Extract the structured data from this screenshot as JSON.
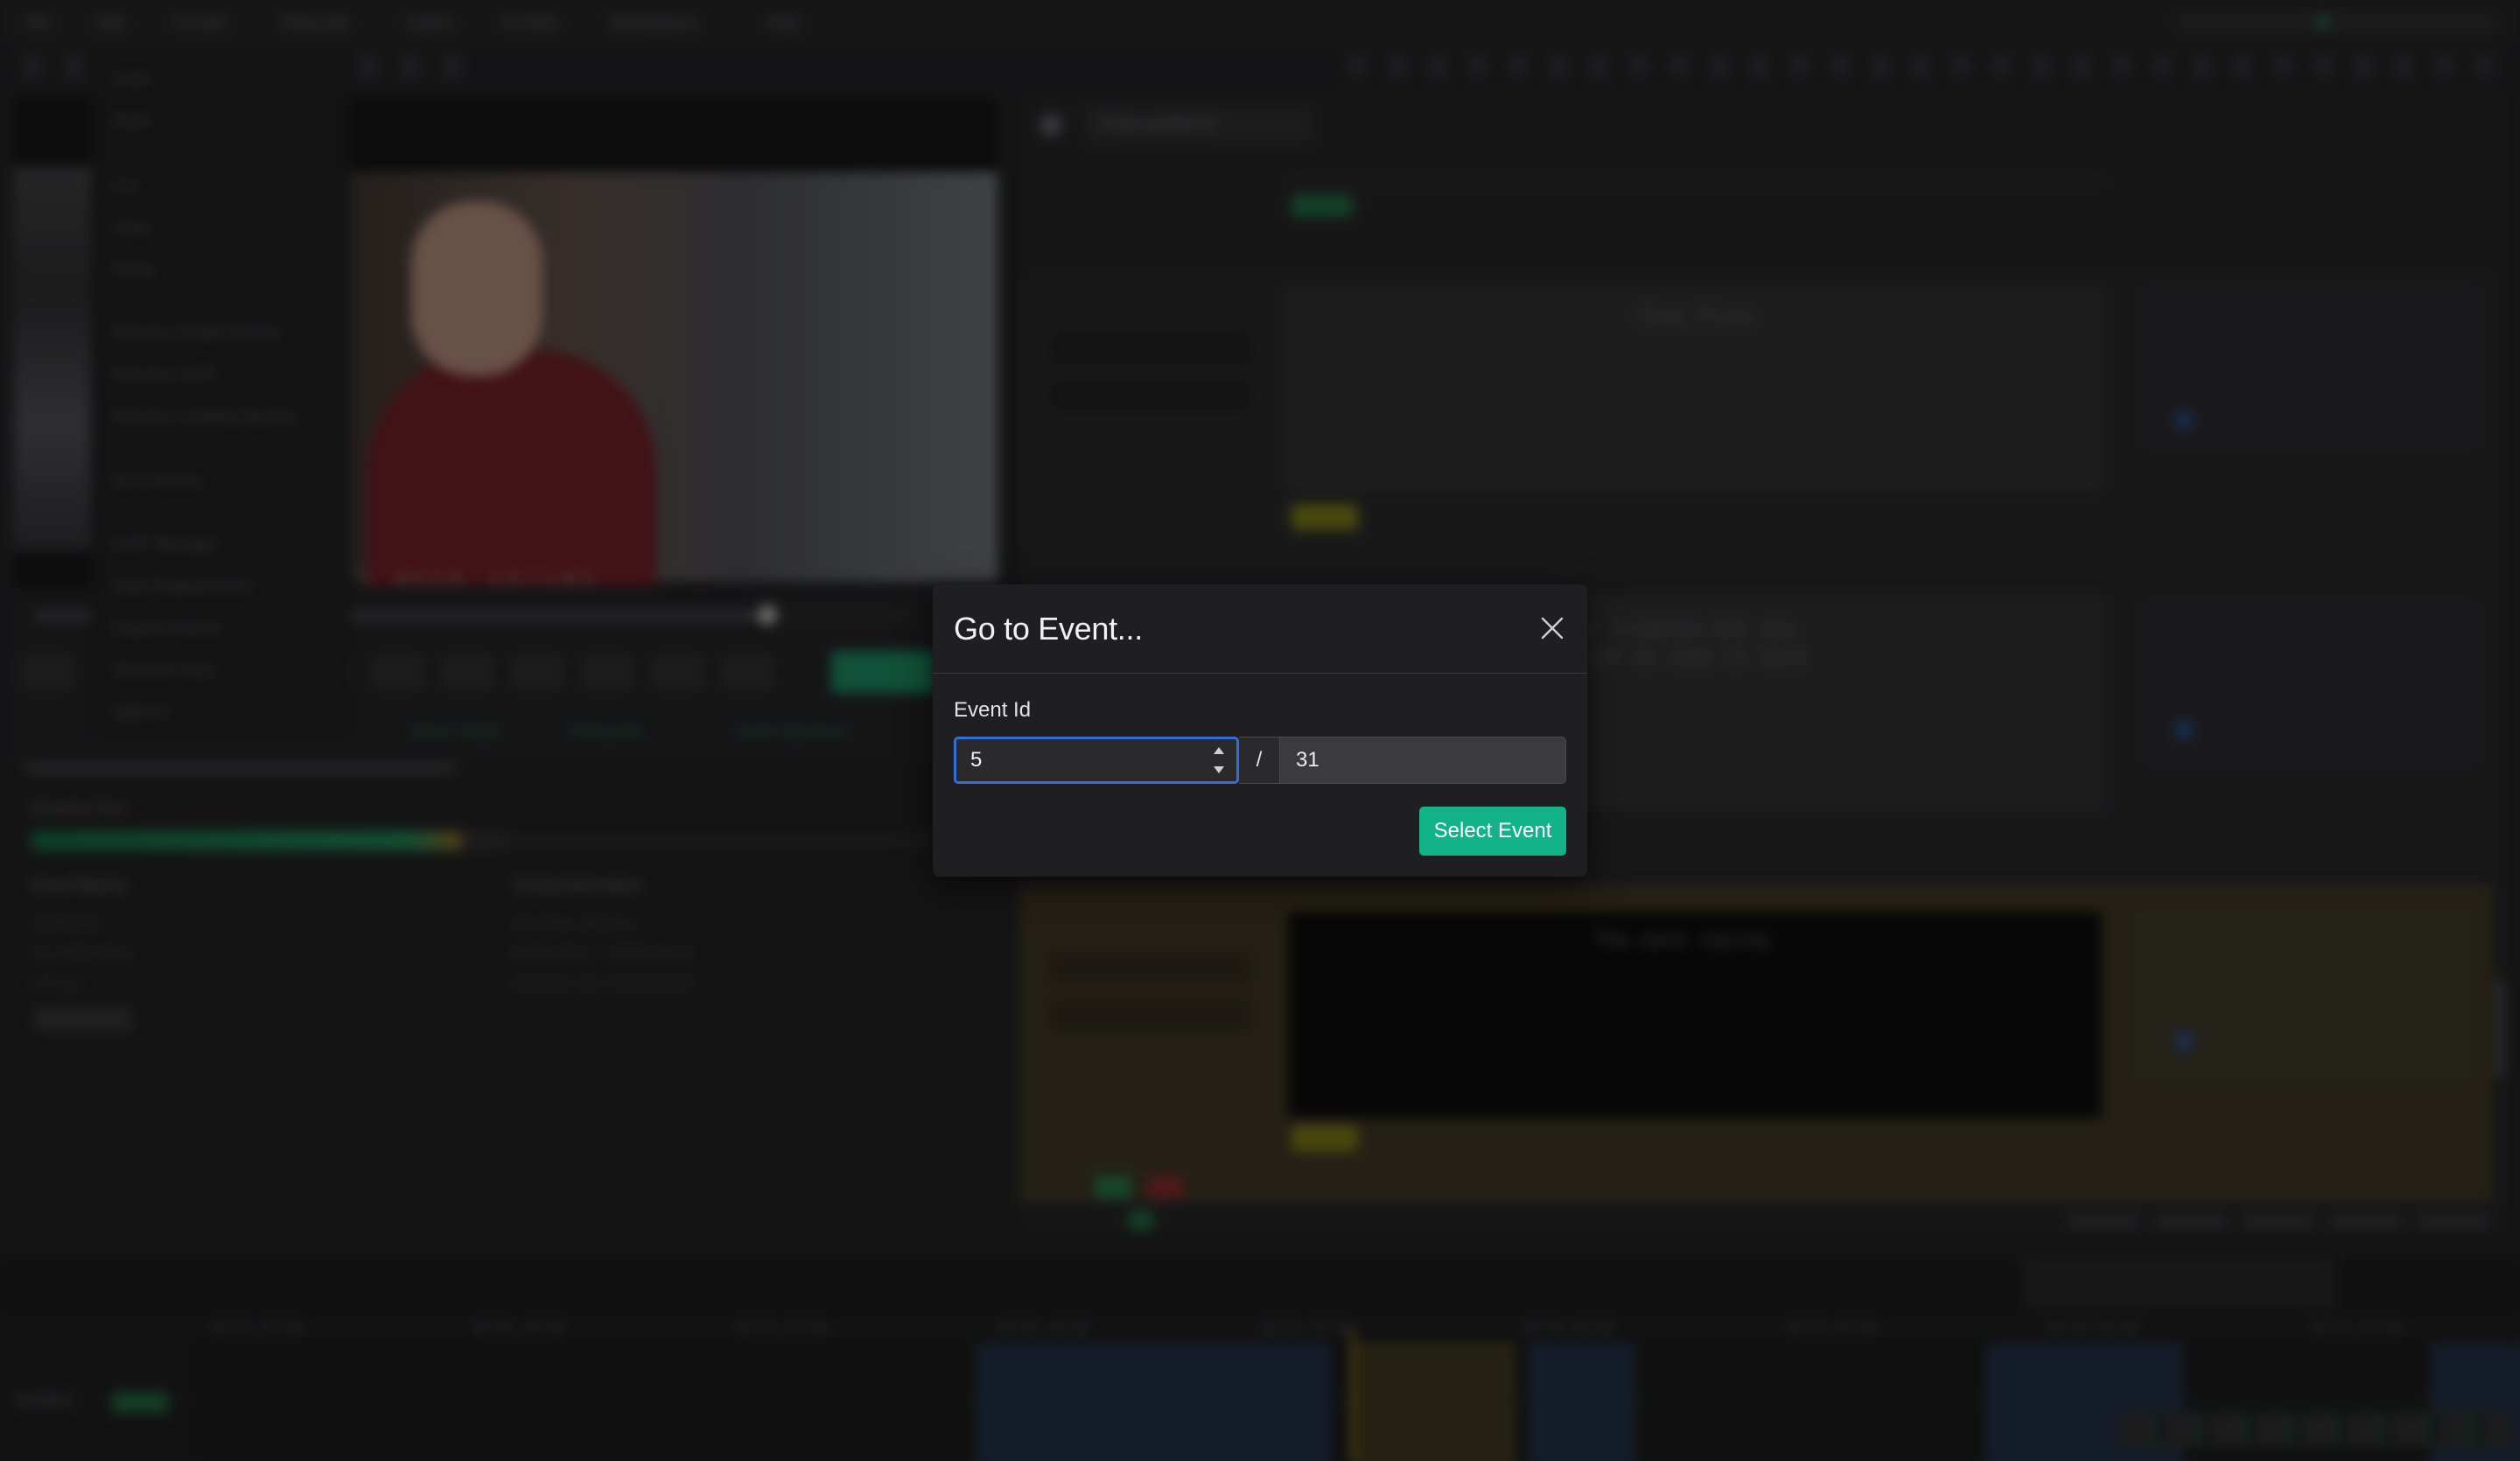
{
  "menubar": {
    "items": [
      "File",
      "Edit",
      "Format",
      "Timecode",
      "Import",
      "AI Tools",
      "Workspaces",
      "Help"
    ]
  },
  "edit_menu": {
    "items": [
      "Undo",
      "Redo",
      "Cut",
      "Copy",
      "Paste",
      "Remove Empty Events",
      "Remove OCR",
      "Remove Leading Spaces",
      "Go to Event...",
      "EXIF Manager",
      "Save Replacement",
      "Export Presets",
      "Shortcut Keys",
      "Options"
    ]
  },
  "background": {
    "subtitle_tab": "Tl-fire-subtitle-01",
    "text_preview": [
      "Time Flies",
      "ii frighten but now\nrush to take it back",
      "The wave saying"
    ],
    "video_caption": "I WEEK SAYING",
    "sections": {
      "event_metrics": "Event Metrics",
      "timing_information": "Timing Information",
      "reading_flow": "Reading Flow"
    },
    "track_label": "Subtitles"
  },
  "dialog": {
    "title": "Go to Event...",
    "field_label": "Event Id",
    "event_id_value": "5",
    "separator": "/",
    "total_events": "31",
    "submit_label": "Select Event",
    "colors": {
      "accent": "#13b38a",
      "focus_ring": "#2f6fd6"
    },
    "icons": {
      "close": "close-icon",
      "spinner_up": "chevron-up-icon",
      "spinner_down": "chevron-down-icon"
    }
  }
}
